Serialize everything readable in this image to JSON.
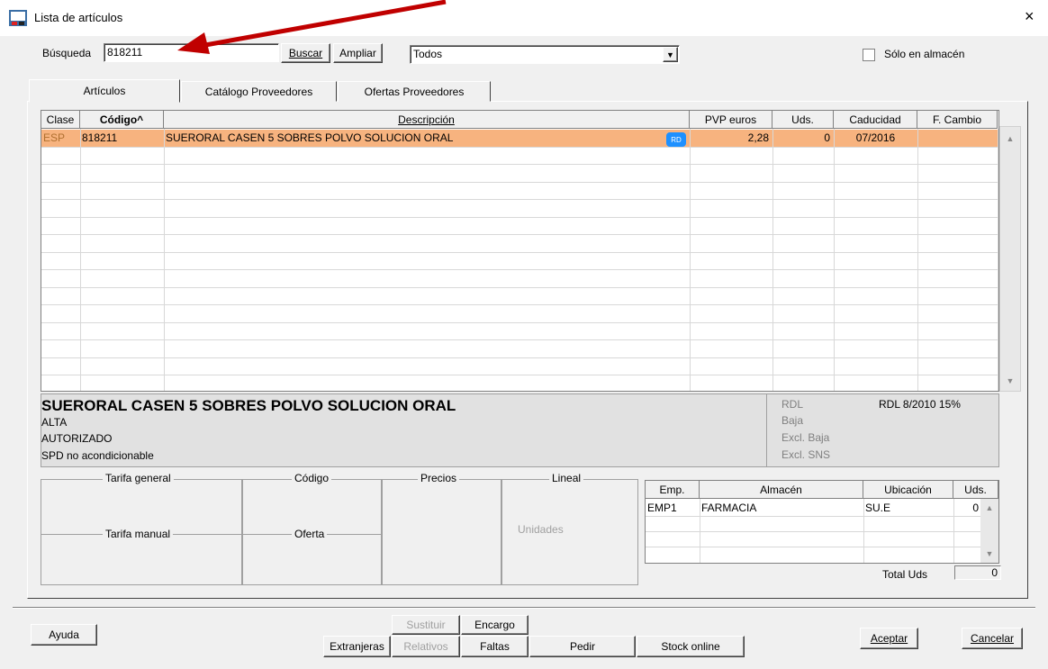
{
  "window": {
    "title": "Lista de artículos",
    "close": "×"
  },
  "search": {
    "label": "Búsqueda",
    "value": "818211",
    "buscar": "Buscar",
    "ampliar": "Ampliar",
    "filter_value": "Todos",
    "solo_almacen_label": "Sólo en almacén"
  },
  "tabs": [
    "Artículos",
    "Catálogo Proveedores",
    "Ofertas Proveedores"
  ],
  "grid": {
    "columns": [
      "Clase",
      "Código^",
      "Descripción",
      "PVP euros",
      "Uds.",
      "Caducidad",
      "F. Cambio"
    ],
    "rows": [
      {
        "clase": "ESP",
        "codigo": "818211",
        "descripcion": "SUERORAL CASEN 5 SOBRES POLVO SOLUCION ORAL",
        "badge": "RD",
        "pvp": "2,28",
        "uds": "0",
        "caducidad": "07/2016",
        "fcambio": ""
      }
    ]
  },
  "info": {
    "name": "SUERORAL CASEN 5 SOBRES POLVO SOLUCION ORAL",
    "line1": "ALTA",
    "line2": "AUTORIZADO",
    "line3": "SPD no acondicionable",
    "rdl": "RDL",
    "rdl_value": "RDL 8/2010 15%",
    "baja": "Baja",
    "excl_baja": "Excl. Baja",
    "excl_sns": "Excl. SNS"
  },
  "pricing": {
    "tarifa_general": "Tarifa general",
    "tarifa_manual": "Tarifa manual",
    "codigo": "Código",
    "oferta": "Oferta",
    "precios": "Precios",
    "lineal": "Lineal",
    "unidades": "Unidades"
  },
  "stock": {
    "columns": [
      "Emp.",
      "Almacén",
      "Ubicación",
      "Uds."
    ],
    "rows": [
      {
        "emp": "EMP1",
        "almacen": "FARMACIA",
        "ubicacion": "SU.E",
        "uds": "0"
      }
    ],
    "total_label": "Total Uds",
    "total_value": "0"
  },
  "footer": {
    "ayuda": "Ayuda",
    "sustituir": "Sustituir",
    "encargo": "Encargo",
    "extranjeras": "Extranjeras",
    "relativos": "Relativos",
    "faltas": "Faltas",
    "pedir": "Pedir",
    "stock_online": "Stock online",
    "aceptar": "Aceptar",
    "cancelar": "Cancelar"
  },
  "colors": {
    "selected_row": "#f7b37f",
    "annotation_arrow": "#c00000",
    "badge": "#1e90ff"
  }
}
